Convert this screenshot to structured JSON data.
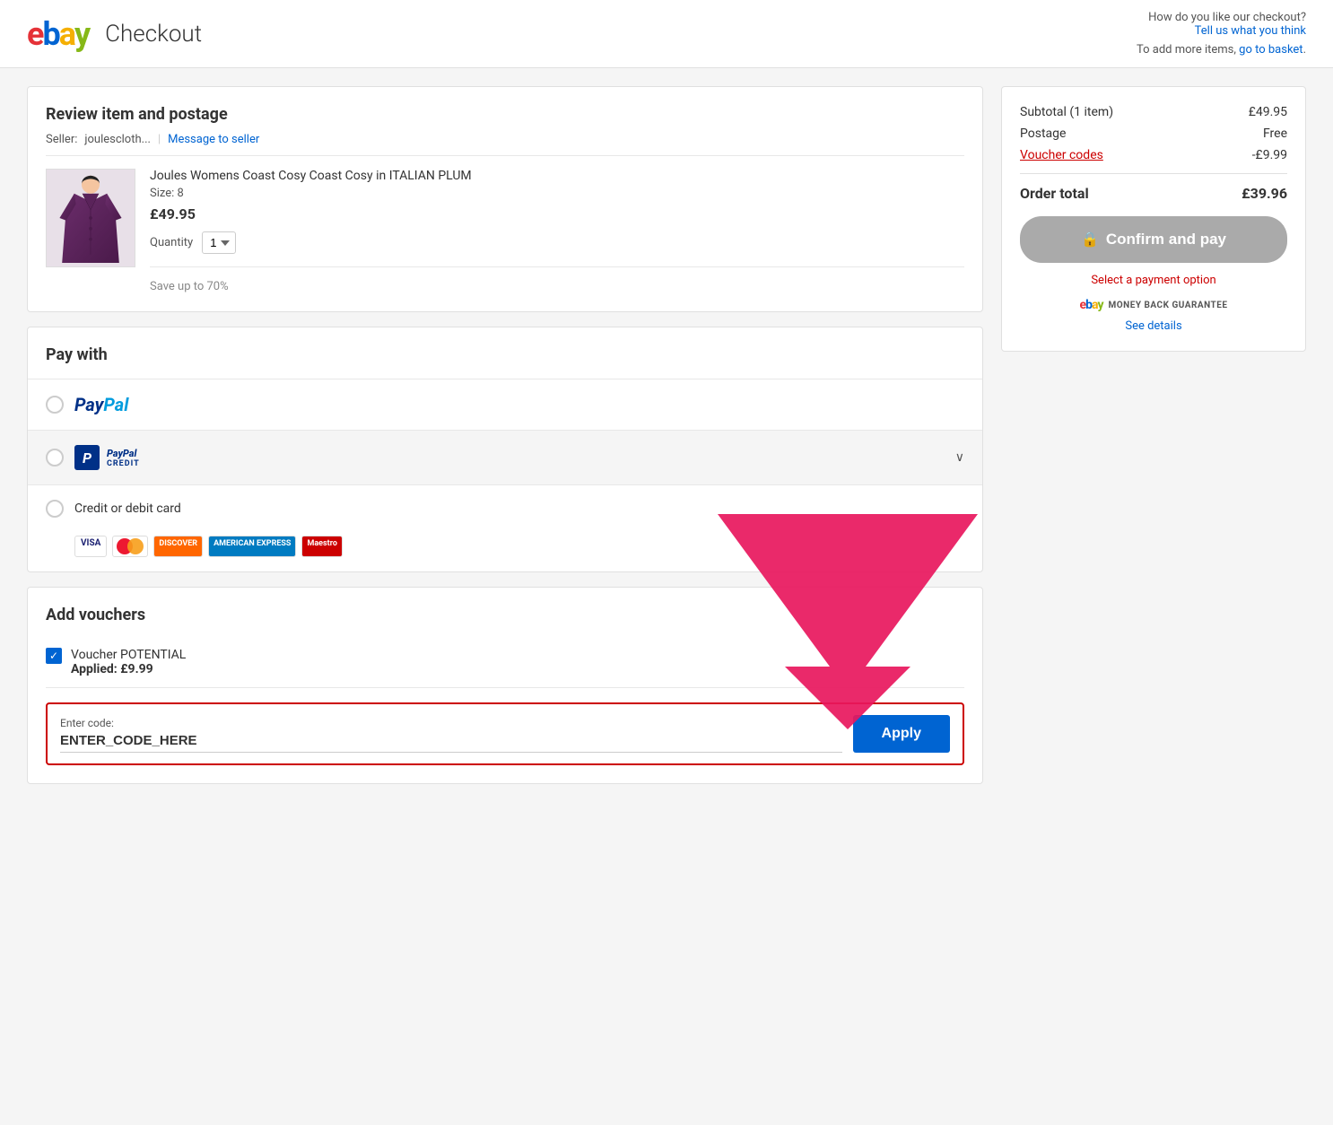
{
  "header": {
    "logo": "ebay",
    "title": "Checkout",
    "feedback_prompt": "How do you like our checkout?",
    "feedback_link": "Tell us what you think",
    "basket_prompt": "To add more items,",
    "basket_link": "go to basket",
    "basket_link_suffix": "."
  },
  "review_section": {
    "title": "Review item and postage",
    "seller_label": "Seller:",
    "seller_name": "joulescloth...",
    "message_seller": "Message to seller",
    "item_name": "Joules Womens Coast Cosy Coast Cosy in ITALIAN PLUM",
    "item_size": "Size: 8",
    "item_price": "£49.95",
    "quantity_label": "Quantity",
    "quantity_value": "1",
    "save_text": "Save up to 70%"
  },
  "payment_section": {
    "title": "Pay with",
    "options": [
      {
        "id": "paypal",
        "label": "PayPal",
        "type": "paypal"
      },
      {
        "id": "paypal-credit",
        "label": "PayPal Credit",
        "type": "paypal-credit",
        "has_chevron": true
      },
      {
        "id": "card",
        "label": "Credit or debit card",
        "type": "card"
      }
    ],
    "card_types": [
      "VISA",
      "Mastercard",
      "Discover",
      "American Express",
      "Maestro"
    ]
  },
  "voucher_section": {
    "title": "Add vouchers",
    "voucher_name": "Voucher POTENTIAL",
    "voucher_applied_label": "Applied:",
    "voucher_applied_value": "£9.99",
    "input_label": "Enter code:",
    "input_placeholder": "ENTER_CODE_HERE",
    "apply_button": "Apply"
  },
  "order_summary": {
    "subtotal_label": "Subtotal (1 item)",
    "subtotal_value": "£49.95",
    "postage_label": "Postage",
    "postage_value": "Free",
    "voucher_label": "Voucher codes",
    "voucher_value": "-£9.99",
    "order_total_label": "Order total",
    "order_total_value": "£39.96",
    "confirm_button": "Confirm and pay",
    "payment_required_msg": "Select a payment option",
    "money_back_text": "MONEY BACK GUARANTEE",
    "see_details": "See details"
  }
}
